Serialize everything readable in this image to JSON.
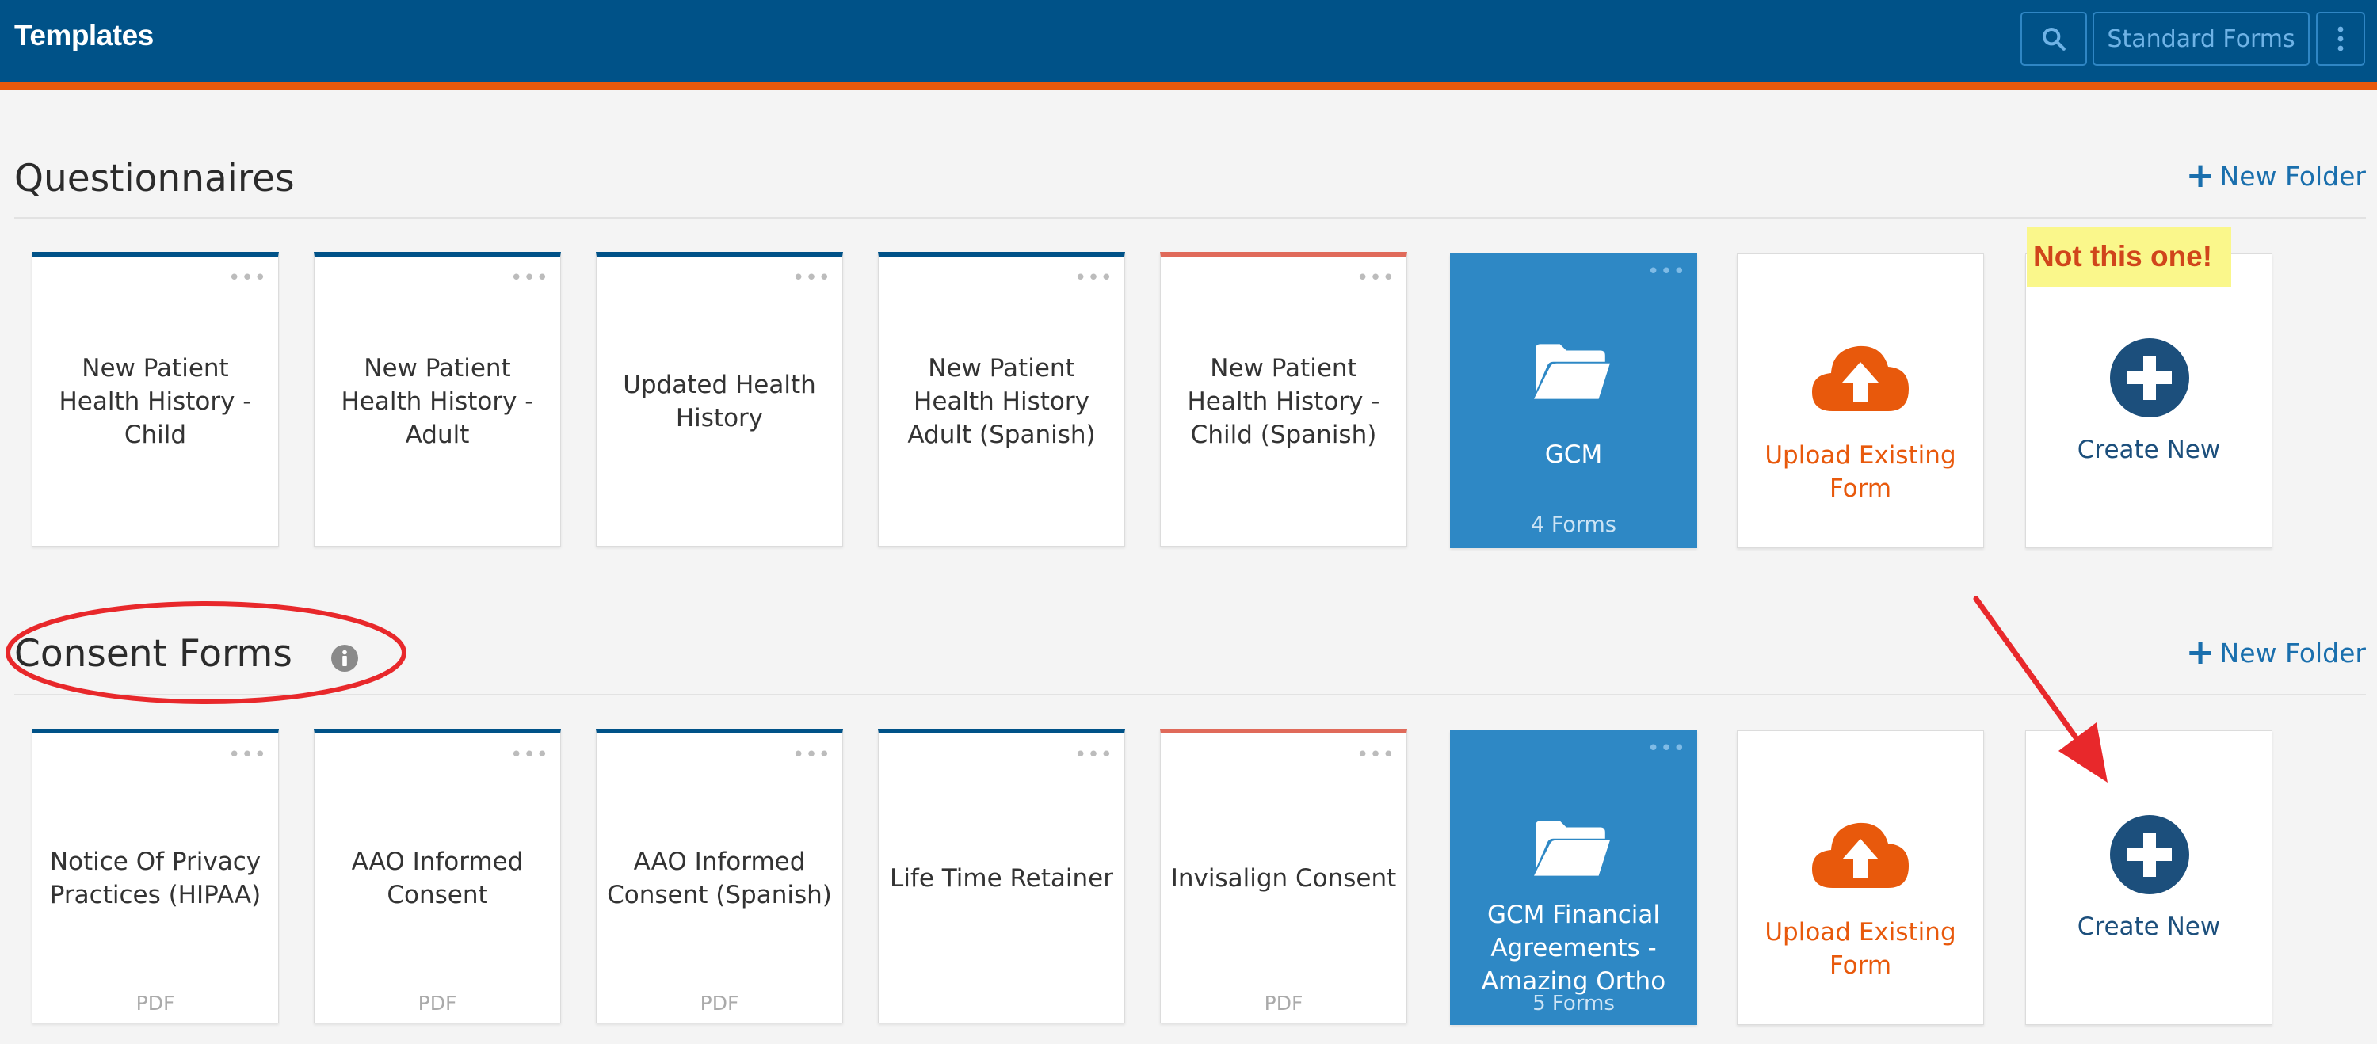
{
  "header": {
    "title": "Templates",
    "standard_forms_label": "Standard Forms"
  },
  "sections": [
    {
      "title": "Questionnaires",
      "new_folder_label": "New Folder",
      "cards": [
        {
          "title": "New Patient Health History - Child"
        },
        {
          "title": "New Patient Health History - Adult"
        },
        {
          "title": "Updated Health History"
        },
        {
          "title": "New Patient Health History Adult (Spanish)"
        },
        {
          "title": "New Patient Health History - Child (Spanish)"
        }
      ],
      "folder": {
        "name": "GCM",
        "count": "4 Forms"
      },
      "upload_label": "Upload Existing Form",
      "create_label": "Create New"
    },
    {
      "title": "Consent Forms",
      "new_folder_label": "New Folder",
      "cards": [
        {
          "title": "Notice Of Privacy Practices (HIPAA)",
          "type": "PDF"
        },
        {
          "title": "AAO Informed Consent",
          "type": "PDF"
        },
        {
          "title": "AAO Informed Consent (Spanish)",
          "type": "PDF"
        },
        {
          "title": "Life Time Retainer"
        },
        {
          "title": "Invisalign Consent",
          "type": "PDF"
        }
      ],
      "folder": {
        "name": "GCM Financial Agreements - Amazing Ortho",
        "count": "5 Forms"
      },
      "upload_label": "Upload Existing Form",
      "create_label": "Create New"
    }
  ],
  "annotation": {
    "note": "Not this one!",
    "color": "#e8282b"
  },
  "colors": {
    "header_bg": "#005288",
    "accent_orange": "#e8590c",
    "folder_blue": "#2e88c5",
    "create_navy": "#1c4f7c"
  },
  "icons": {
    "search": "search-icon",
    "more": "vertical-dots-icon",
    "folder": "folder-open-icon",
    "upload": "cloud-upload-icon",
    "create": "plus-circle-icon",
    "info": "info-icon"
  }
}
